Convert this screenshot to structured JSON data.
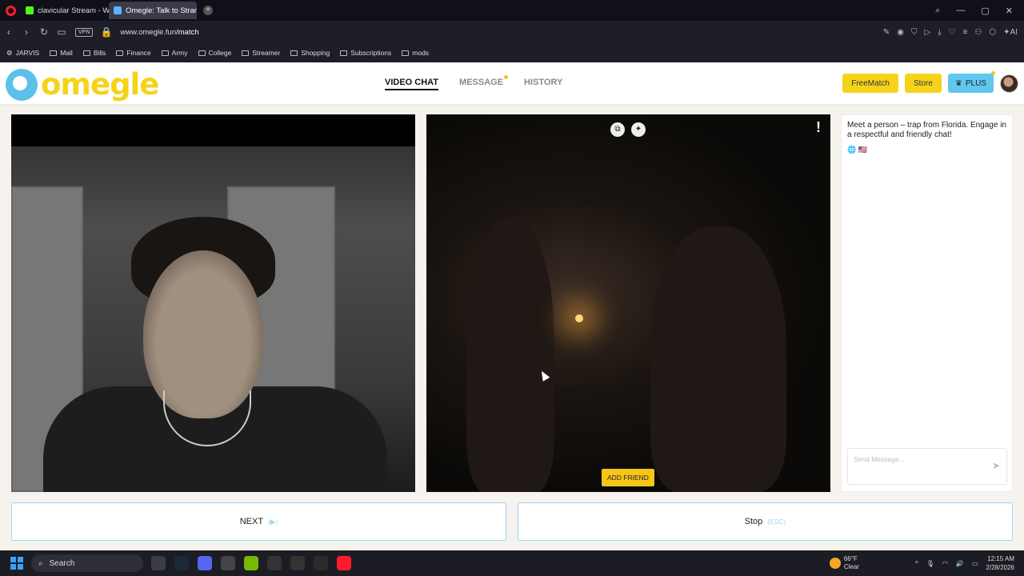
{
  "browser": {
    "tabs": [
      {
        "title": "clavicular Stream - Watch"
      },
      {
        "title": "Omegle: Talk to Strang"
      }
    ],
    "vpn_label": "VPN",
    "url_domain": "www.omegle.fun",
    "url_path": "/match",
    "ai_label": "AI",
    "bookmarks": [
      "JARVIS",
      "Mail",
      "Bills",
      "Finance",
      "Army",
      "College",
      "Streamer",
      "Shopping",
      "Subscriptions",
      "mods"
    ]
  },
  "site": {
    "logo": "omegle",
    "nav": [
      {
        "label": "VIDEO CHAT",
        "active": true
      },
      {
        "label": "MESSAGE",
        "has_dot": true
      },
      {
        "label": "HISTORY"
      }
    ],
    "buttons": {
      "freematch": "FreeMatch",
      "store": "Store",
      "plus": "PLUS"
    }
  },
  "video": {
    "peer": {
      "report_icon": "!",
      "add_friend": "ADD FRIEND"
    }
  },
  "chat": {
    "intro": "Meet a person – trap from Florida. Engage in a respectful and friendly chat!",
    "emoji": "🌐 🇺🇸",
    "placeholder": "Send Message..."
  },
  "controls": {
    "next_label": "NEXT",
    "next_hint": "(▶)",
    "stop_label": "Stop",
    "stop_hint": "(ESC)"
  },
  "taskbar": {
    "search_label": "Search",
    "weather_temp": "66°F",
    "weather_desc": "Clear",
    "time": "12:15 AM",
    "date": "2/28/2026"
  },
  "colors": {
    "accent_yellow": "#f5d31a",
    "accent_blue": "#5cc1ea",
    "opera_red": "#ff1b2d"
  }
}
